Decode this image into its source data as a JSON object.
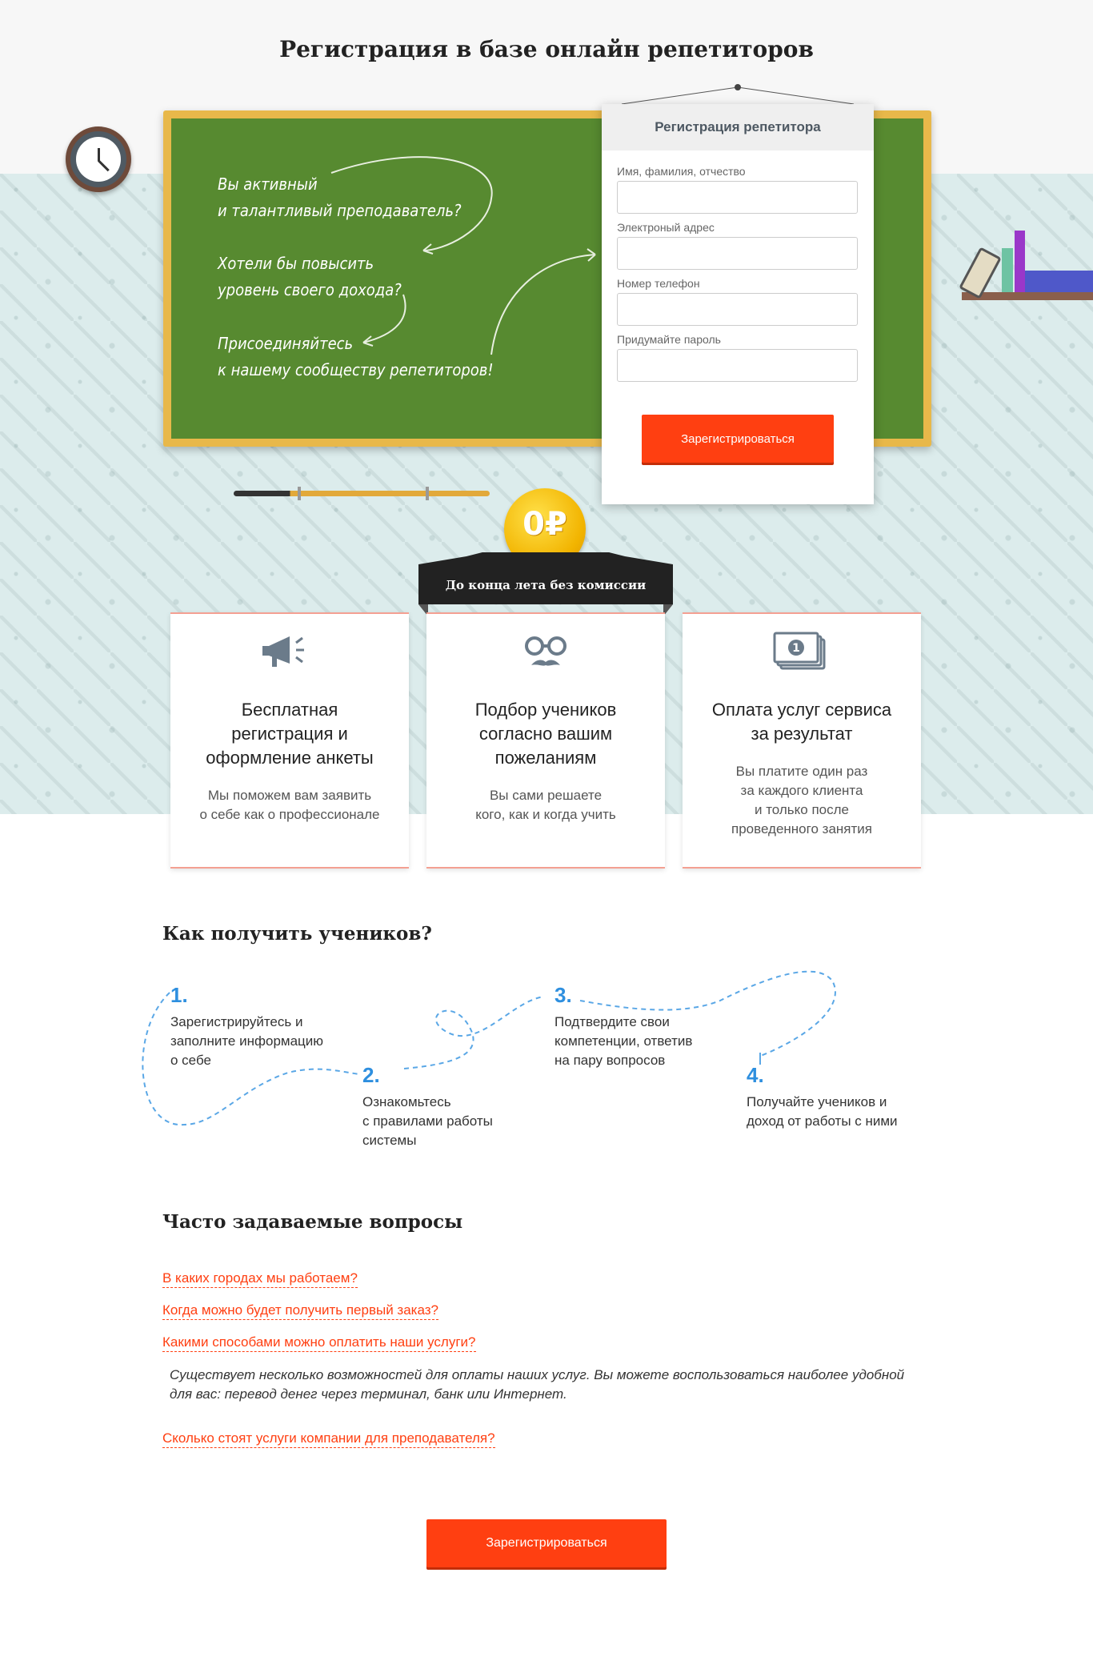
{
  "page": {
    "title": "Регистрация в базе онлайн репетиторов"
  },
  "board": {
    "lines": [
      [
        "Вы активный",
        "и талантливый преподаватель?"
      ],
      [
        "Хотели бы повысить",
        "уровень своего дохода?"
      ],
      [
        "Присоединяйтесь",
        "к нашему сообществу репетиторов!"
      ]
    ]
  },
  "registration": {
    "title": "Регистрация репетитора",
    "fields": [
      {
        "label": "Имя, фамилия, отчество",
        "value": ""
      },
      {
        "label": "Электроный адрес",
        "value": ""
      },
      {
        "label": "Номер телефон",
        "value": ""
      },
      {
        "label": "Придумайте пароль",
        "value": ""
      }
    ],
    "submit_label": "Зарегистрироваться"
  },
  "promo": {
    "coin_label": "0₽",
    "ribbon_text": "До конца лета без комиссии"
  },
  "features": [
    {
      "icon": "megaphone-icon",
      "title": [
        "Бесплатная",
        "регистрация и",
        "оформление анкеты"
      ],
      "text": [
        "Мы поможем вам заявить",
        "о себе как о профессионале"
      ]
    },
    {
      "icon": "glasses-mustache-icon",
      "title": [
        "Подбор учеников",
        "согласно вашим",
        "пожеланиям"
      ],
      "text": [
        "Вы сами решаете",
        "кого, как и когда учить"
      ]
    },
    {
      "icon": "money-icon",
      "title": [
        "Оплата услуг сервиса",
        "за результат"
      ],
      "text": [
        "Вы платите один раз",
        "за каждого клиента",
        "и только после",
        "проведенного занятия"
      ]
    }
  ],
  "how_to": {
    "title": "Как получить учеников?",
    "steps": [
      {
        "num": "1.",
        "text": [
          "Зарегистрируйтесь и",
          "заполните информацию",
          "о себе"
        ]
      },
      {
        "num": "2.",
        "text": [
          "Ознакомьтесь",
          "с правилами работы",
          "системы"
        ]
      },
      {
        "num": "3.",
        "text": [
          "Подтвердите свои",
          "компетенции, ответив",
          "на пару вопросов"
        ]
      },
      {
        "num": "4.",
        "text": [
          "Получайте учеников и",
          "доход от работы с ними"
        ]
      }
    ]
  },
  "faq": {
    "title": "Часто задаваемые вопросы",
    "questions": [
      "В каких городах мы работаем?",
      "Когда можно будет получить первый заказ?",
      "Какими способами можно оплатить наши услуги?",
      "Сколько стоят услуги компании для преподавателя?"
    ],
    "answer": [
      "Существует несколько возможностей для оплаты наших услуг. Вы можете воспользоваться наиболее удобной",
      "для вас: перевод денег через терминал, банк или Интернет."
    ]
  },
  "cta": {
    "label": "Зарегистрироваться"
  },
  "colors": {
    "accent": "#ff3f11",
    "board": "#578a30",
    "frame": "#e8b84a",
    "step": "#2e8fdf"
  }
}
